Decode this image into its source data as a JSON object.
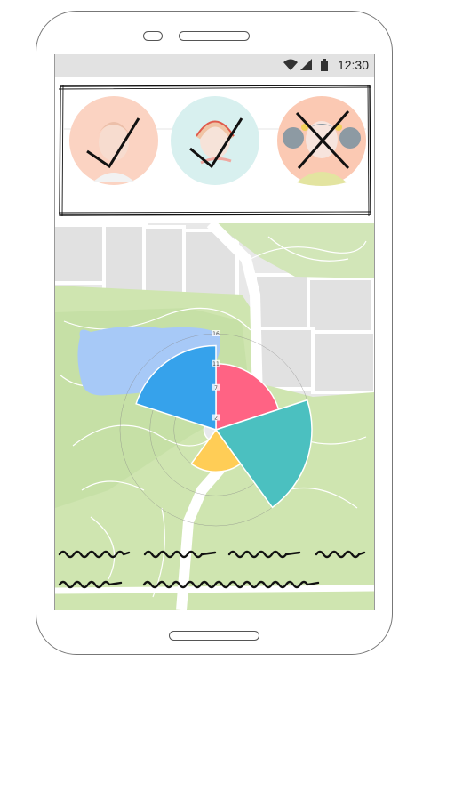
{
  "status_bar": {
    "time": "12:30",
    "icons": [
      "wifi-icon",
      "signal-icon",
      "battery-icon"
    ]
  },
  "avatars": [
    {
      "name": "avatar-man",
      "state": "checked",
      "background": "#fbd3c2"
    },
    {
      "name": "avatar-woman-headset",
      "state": "checked",
      "background": "#d8f0ef"
    },
    {
      "name": "avatar-girl-pigtails",
      "state": "crossed",
      "background": "#fbc9b3"
    }
  ],
  "chart_data": {
    "type": "polar-area",
    "radial_ticks": [
      "16",
      "11",
      "7",
      "2"
    ],
    "segments": [
      {
        "color": "#ff6384",
        "value": 11
      },
      {
        "color": "#4bc0c0",
        "value": 16
      },
      {
        "color": "#ffcd56",
        "value": 7
      },
      {
        "color": "#e7e9ed",
        "value": 2
      },
      {
        "color": "#36a2eb",
        "value": 14
      }
    ]
  },
  "scribble_lines": 2
}
